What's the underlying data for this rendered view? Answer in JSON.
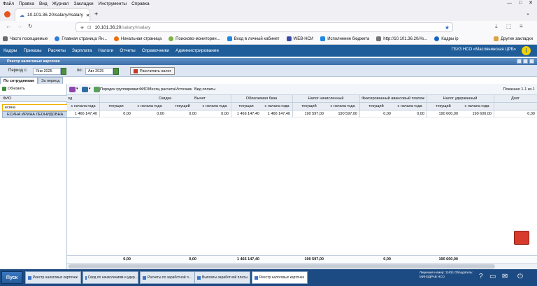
{
  "browser": {
    "menu": [
      "Файл",
      "Правка",
      "Вид",
      "Журнал",
      "Закладки",
      "Инструменты",
      "Справка"
    ],
    "tab_title": "10.101.36.20/salary/#salary",
    "new_tab": "+",
    "url_host": "10.101.36.20",
    "url_path": "/salary/#salary",
    "bookmarks": [
      {
        "label": "Часто посещаемые",
        "color": "#6b6b6b"
      },
      {
        "label": "Главная страница Ян...",
        "color": "#2a7de1"
      },
      {
        "label": "Начальная страница",
        "color": "#ef6c00"
      },
      {
        "label": "Поисково-мониторин...",
        "color": "#7cb342"
      },
      {
        "label": "Вход в личный кабинет",
        "color": "#1e88e5"
      },
      {
        "label": "WEB-НСИ",
        "color": "#3949ab"
      },
      {
        "label": "Исполнение бюджета",
        "color": "#1e88e5"
      },
      {
        "label": "http://10.101.36.20/#s...",
        "color": "#757575"
      },
      {
        "label": "Кадры ip",
        "color": "#1565c0"
      }
    ],
    "other_bookmarks": "Другие закладки"
  },
  "appnav": {
    "items": [
      "Кадры",
      "Приказы",
      "Расчеты",
      "Зарплата",
      "Налоги",
      "Отчеты",
      "Справочники",
      "Администрирование"
    ],
    "org": "ГБУЗ НСО «Маслянинская ЦРБ»",
    "info": "i"
  },
  "window": {
    "title": "Реестр налоговых карточек"
  },
  "filter": {
    "period_label": "Период с:",
    "from": "Янв 2025",
    "to_label": "по:",
    "to": "Авг 2025",
    "calc_button": "Рассчитать налог"
  },
  "left": {
    "tabs": [
      "По сотрудникам",
      "За период"
    ],
    "refresh": "Обновить",
    "fio_header": "ФИО",
    "search_value": "есина",
    "suggestion": "ЕСИНА ИРИНА ЛЕОНИДОВНА"
  },
  "toolbar": {
    "grouping_label": "Порядок группировки:",
    "groups": [
      "ФИО",
      "Месяц расчета",
      "Источник",
      "Вид оплаты"
    ],
    "page_info": "Показано 1-1 из 1"
  },
  "table": {
    "groups": [
      {
        "label": "од"
      },
      {
        "label": "Скидка"
      },
      {
        "label": "Вычет"
      },
      {
        "label": "Облагаемая база"
      },
      {
        "label": "Налог начисленный"
      },
      {
        "label": "Фиксированный авансовый платеж"
      },
      {
        "label": "Налог удержанный"
      },
      {
        "label": "Долг"
      }
    ],
    "subheaders": [
      "с начала года",
      "текущая",
      "с начала года",
      "текущий",
      "с начала года",
      "текущая",
      "с начала года",
      "текущий",
      "с начала года",
      "текущий",
      "с начала года",
      "текущий",
      "с начала года",
      ""
    ],
    "row": [
      "1 466 147,40",
      "0,00",
      "0,00",
      "0,00",
      "0,00",
      "1 466 147,40",
      "1 466 147,40",
      "190 597,00",
      "190 597,00",
      "0,00",
      "0,00",
      "190 600,00",
      "190 600,00",
      "0,00"
    ],
    "totals": [
      "0,00",
      "0,00",
      "1 466 147,40",
      "190 597,00",
      "0,00",
      "190 600,00"
    ]
  },
  "taskbar": {
    "start": "Пуск",
    "tasks": [
      {
        "label": "Реестр налоговых карточек",
        "active": false
      },
      {
        "label": "Свод по начислениям и удер...",
        "active": false
      },
      {
        "label": "Расчеты по заработной п...",
        "active": false
      },
      {
        "label": "Выплаты заработной платы",
        "active": false
      },
      {
        "label": "Реестр налоговых карточек",
        "active": true
      }
    ],
    "license": "Лицензия номер: 1163с Обладатель: МИНЗДРАВ НСО"
  }
}
